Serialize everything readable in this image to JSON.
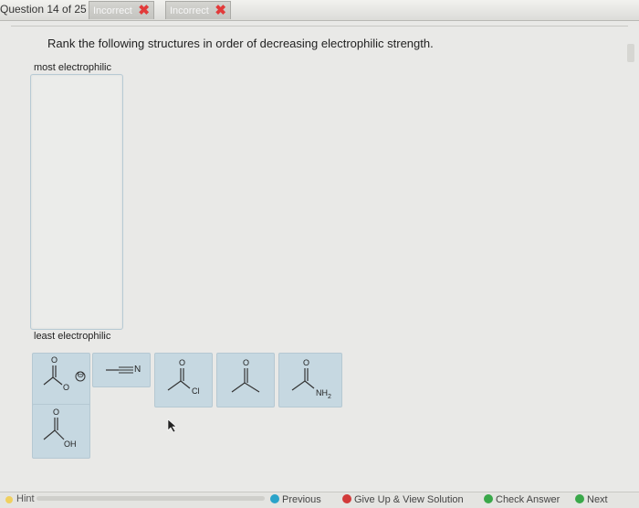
{
  "header": {
    "question_label": "Question 14 of 25",
    "attempts": [
      "Incorrect",
      "Incorrect"
    ]
  },
  "question": {
    "prompt": "Rank the following structures in order of decreasing electrophilic strength.",
    "most_label": "most electrophilic",
    "least_label": "least electrophilic"
  },
  "tiles": {
    "carboxylate_charge": "⊖",
    "nitrile_label": "N",
    "acyl_chloride_label": "Cl",
    "amide_label": "NH",
    "amide_sub": "2",
    "acid_label": "OH",
    "oxygen": "O"
  },
  "footer": {
    "hint": "Hint",
    "previous": "Previous",
    "give_up": "Give Up & View Solution",
    "check": "Check Answer",
    "next": "Next"
  },
  "colors": {
    "tile": "#c6d8e1",
    "incorrect_x": "#e23a3a",
    "previous_icon": "#2aa3c9",
    "give_up_icon": "#d23a3a",
    "check_icon": "#3aa84a"
  }
}
